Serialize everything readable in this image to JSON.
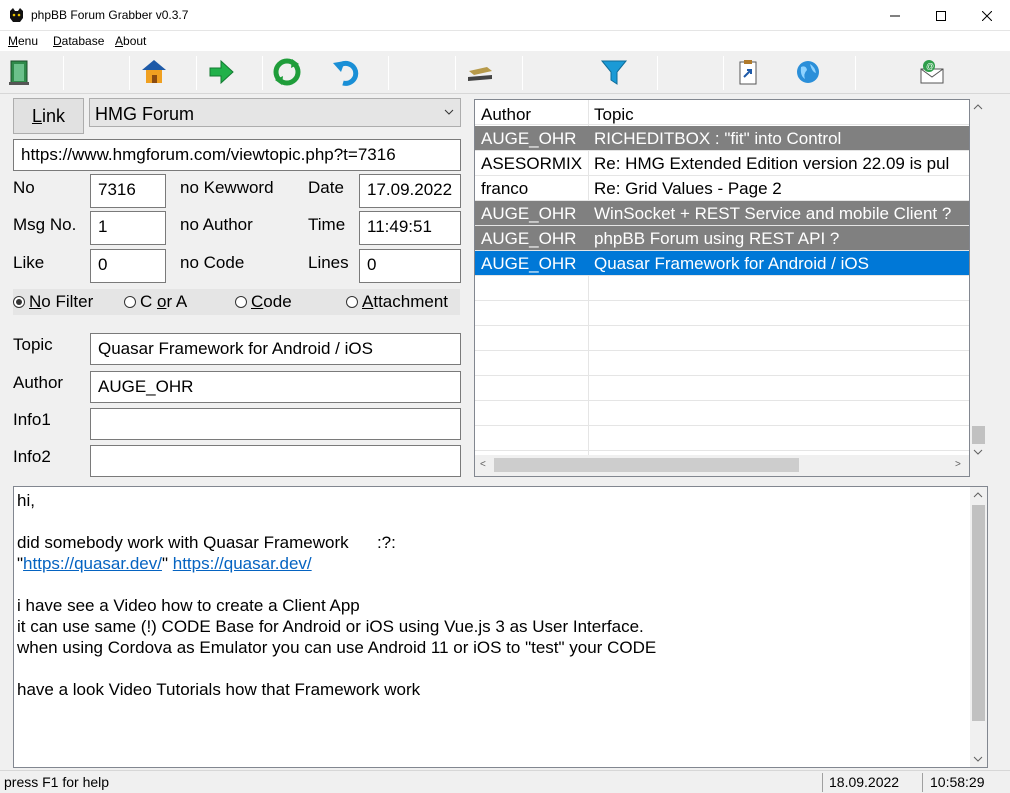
{
  "window": {
    "title": "phpBB Forum Grabber v0.3.7"
  },
  "menu": [
    {
      "label": "Menu",
      "accel": "M",
      "rest": "enu"
    },
    {
      "label": "Database",
      "accel": "D",
      "rest": "atabase"
    },
    {
      "label": "About",
      "accel": "A",
      "rest": "bout"
    }
  ],
  "toolbar": {
    "icons": [
      "exit-door-icon",
      "house-icon",
      "forward-arrow-icon",
      "refresh-icon",
      "redo-icon",
      "stapler-icon",
      "filter-funnel-icon",
      "clipboard-icon",
      "globe-icon",
      "email-icon"
    ]
  },
  "form": {
    "link_label": "Link",
    "link_accel": "L",
    "link_rest": "ink",
    "forum": "HMG Forum",
    "url": "https://www.hmgforum.com/viewtopic.php?t=7316",
    "no_label": "No",
    "no_value": "7316",
    "no_keyword": "no Kewword",
    "date_label": "Date",
    "date_value": "17.09.2022",
    "msgno_label": "Msg No.",
    "msgno_value": "1",
    "no_author": "no Author",
    "time_label": "Time",
    "time_value": "11:49:51",
    "like_label": "Like",
    "like_value": "0",
    "no_code": "no Code",
    "lines_label": "Lines",
    "lines_value": "0",
    "topic_label": "Topic",
    "topic_value": "Quasar Framework for Android / iOS",
    "author_label": "Author",
    "author_value": "AUGE_OHR",
    "info1_label": "Info1",
    "info1_value": "",
    "info2_label": "Info2",
    "info2_value": ""
  },
  "filter": {
    "options": [
      {
        "accel": "N",
        "rest": "o Filter",
        "selected": true
      },
      {
        "pre": "C ",
        "accel": "o",
        "rest": "r A",
        "selected": false
      },
      {
        "accel": "C",
        "rest": "ode",
        "selected": false
      },
      {
        "accel": "A",
        "rest": "ttachment",
        "selected": false
      }
    ]
  },
  "grid": {
    "headers": [
      "Author",
      "Topic"
    ],
    "rows": [
      {
        "author": "AUGE_OHR",
        "topic": "RICHEDITBOX : \"fit\" into Control",
        "style": "dark"
      },
      {
        "author": "ASESORMIX",
        "topic": "Re: HMG Extended Edition version 22.09 is pul",
        "style": "normal"
      },
      {
        "author": "franco",
        "topic": "Re: Grid Values - Page 2",
        "style": "normal"
      },
      {
        "author": "AUGE_OHR",
        "topic": "WinSocket + REST Service and mobile Client ?",
        "style": "dark"
      },
      {
        "author": "AUGE_OHR",
        "topic": "phpBB Forum using REST API ?",
        "style": "dark"
      },
      {
        "author": "AUGE_OHR",
        "topic": "Quasar Framework for Android / iOS",
        "style": "selected"
      }
    ]
  },
  "message": {
    "l1": "hi,",
    "l2": "did somebody work with Quasar Framework      :?:",
    "l3_q1": "\"",
    "l3_link1": "https://quasar.dev/",
    "l3_q2": "\" ",
    "l3_link2": "https://quasar.dev/",
    "l4": "i have see a Video how to create a Client App",
    "l5": "it can use same (!) CODE Base for Android or iOS using Vue.js 3 as User Interface.",
    "l6": "when using Cordova as Emulator you can use Android 11 or iOS to \"test\" your CODE",
    "l7": "have a look Video Tutorials how that Framework work"
  },
  "status": {
    "help": "press F1 for help",
    "date": "18.09.2022",
    "time": "10:58:29"
  }
}
